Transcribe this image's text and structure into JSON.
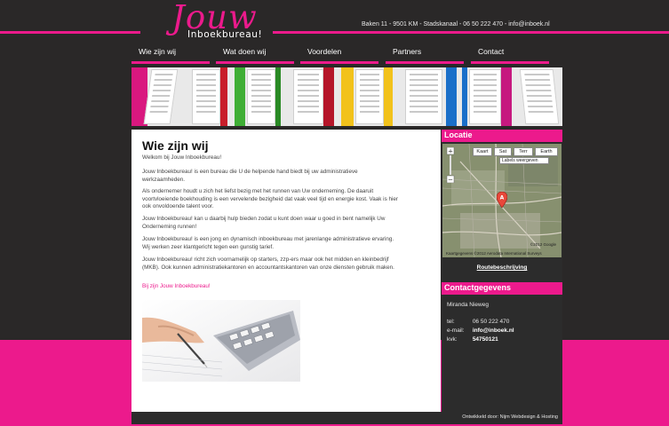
{
  "header": {
    "logo_script": "Jouw",
    "logo_sub": "Inboekbureau!",
    "contact_line": "Baken 11 - 9501 KM - Stadskanaal - 06 50 222 470 - info@inboek.nl"
  },
  "nav": {
    "items": [
      {
        "label": "Wie zijn wij"
      },
      {
        "label": "Wat doen wij"
      },
      {
        "label": "Voordelen"
      },
      {
        "label": "Partners"
      },
      {
        "label": "Contact"
      }
    ]
  },
  "main": {
    "title": "Wie zijn wij",
    "welcome": "Welkom bij Jouw Inboekbureau!",
    "p1": "Jouw Inboekbureau! is een bureau die U de helpende hand biedt bij uw administratieve werkzaamheden.",
    "p2": "Als ondernemer houdt u zich het liefst bezig met het runnen van Uw onderneming. De daaruit voortvloeiende boekhouding is een vervelende bezigheid dat vaak veel tijd en energie kost. Vaak is hier ook onvoldoende talent voor.",
    "p3": "Jouw Inboekbureau! kan u daarbij hulp bieden zodat u kunt doen waar u goed in bent namelijk Uw Onderneming runnen!",
    "p4": "Jouw Inboekbureau! is een jong en dynamisch inboekbureau met jarenlange administratieve ervaring. Wij werken zeer klantgericht tegen een gunstig tarief.",
    "p5": "Jouw Inboekbureau! richt zich voornamelijk op starters, zzp-ers maar ook het midden en kleinbedrijf (MKB). Ook kunnen administratiekantoren en accountantskantoren van onze diensten gebruik maken.",
    "link": "Bij zijn Jouw Inboekbureau!"
  },
  "sidebar": {
    "locatie_title": "Locatie",
    "map_buttons": [
      "Kaart",
      "Sat",
      "Terr",
      "Earth"
    ],
    "map_checkbox": "Labels weergeven",
    "map_copyright": "Kaartgegevens ©2012 Aerodata International Surveys",
    "map_copy_right": "©2012 Google",
    "route_link": "Routebeschrijving",
    "contact_title": "Contactgegevens",
    "name": "Miranda Nieweg",
    "tel_label": "tel:",
    "tel_value": "06 50 222 470",
    "email_label": "e-mail:",
    "email_value": "info@inboek.nl",
    "kvk_label": "kvk:",
    "kvk_value": "54750121"
  },
  "footer": {
    "credit": "Ontwikkeld door: Nijm Webdesign & Hosting"
  },
  "colors": {
    "accent": "#ec1a8c",
    "background": "#2a2828",
    "panel": "#2c2c2c"
  },
  "icons": {
    "map_pin": "location-marker-icon",
    "zoom": "zoom-control-icon"
  }
}
